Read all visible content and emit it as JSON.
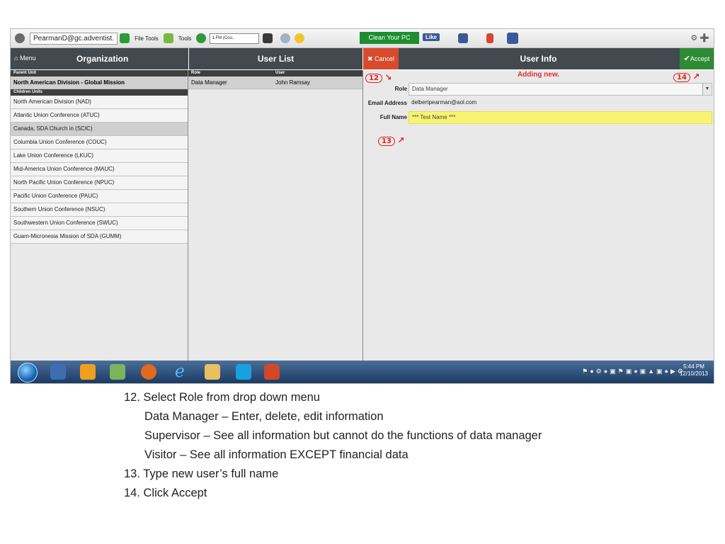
{
  "browser_toolbar": {
    "account": "PearmanD@gc.adventist.",
    "file_tools": "File Tools",
    "tools": "Tools",
    "media_station": "1.FM (Cou..",
    "clean_pc": "Clean Your PC",
    "fb_like": "Like"
  },
  "org_panel": {
    "menu_label": "Menu",
    "title": "Organization",
    "parent_header": "Parent Unit",
    "parent_name": "North American Division - Global Mission",
    "children_header": "Children Units",
    "children": [
      "North American Division (NAD)",
      "Atlantic Union Conference (ATUC)",
      "Canada, SDA Church in (SCIC)",
      "Columbia Union Conference (COUC)",
      "Lake Union Conference (LKUC)",
      "Mid-America Union Conference (MAUC)",
      "North Pacific Union Conference (NPUC)",
      "Pacific Union Conference (PAUC)",
      "Southern Union Conference (NSUC)",
      "Southwestern Union Conference (SWUC)",
      "Guam-Micronesia Mission of SDA (GUMM)"
    ]
  },
  "user_list": {
    "title": "User List",
    "col_role": "Role",
    "col_user": "User",
    "rows": [
      {
        "role": "Data Manager",
        "user": "John Ramsay"
      }
    ]
  },
  "user_info": {
    "cancel_label": "Cancel",
    "title": "User Info",
    "accept_label": "Accept",
    "status": "Adding new.",
    "role_label": "Role",
    "role_value": "Data Manager",
    "email_label": "Email Address",
    "email_value": "delbertpearman@aol.com",
    "fullname_label": "Full Name",
    "fullname_value": "*** Test Name ***"
  },
  "annotations": {
    "a12": "12",
    "a13": "13",
    "a14": "14"
  },
  "taskbar": {
    "time": "5:44 PM",
    "date": "12/10/2013"
  },
  "instructions": {
    "step12": "12. Select Role from drop down menu",
    "role_data_manager": "Data Manager – Enter, delete, edit information",
    "role_supervisor": "Supervisor – See all information but cannot do the functions of data manager",
    "role_visitor": "Visitor – See all information EXCEPT financial data",
    "step13": "13. Type new user’s full name",
    "step14": "14.  Click Accept"
  },
  "colors": {
    "header_bg": "#424a4f",
    "cancel": "#d84a2c",
    "accept": "#2e8a35",
    "highlight_yellow": "#f8f372",
    "annotation_red": "#e0201a"
  }
}
